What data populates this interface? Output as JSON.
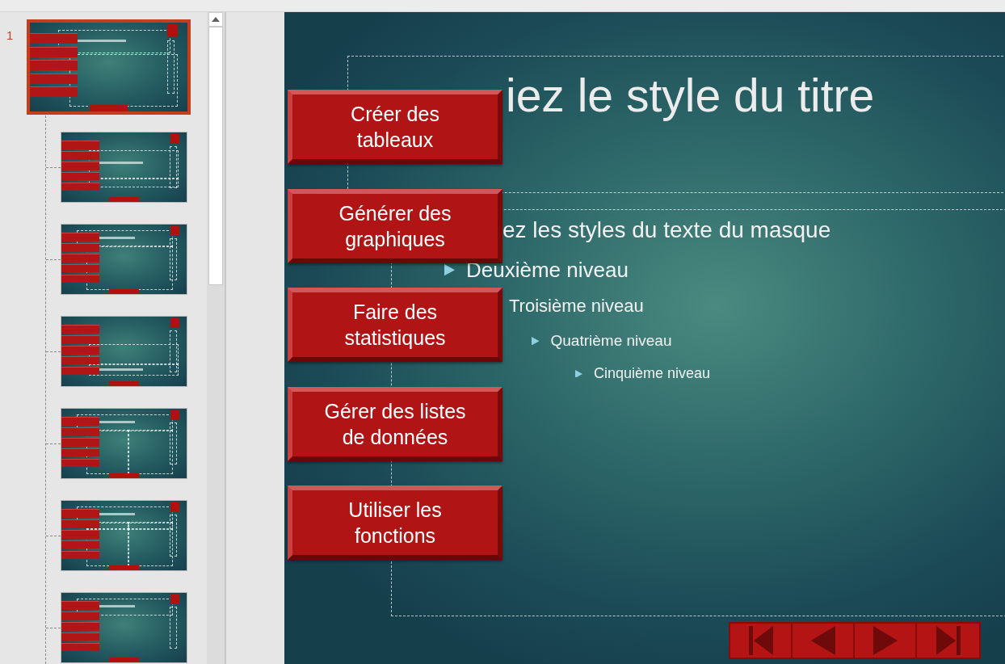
{
  "thumbnails_panel": {
    "slide_number": "1",
    "thumbnails": [
      {
        "kind": "master",
        "selected": true
      },
      {
        "kind": "title",
        "selected": false
      },
      {
        "kind": "content",
        "selected": false
      },
      {
        "kind": "section",
        "selected": false
      },
      {
        "kind": "two-content",
        "selected": false
      },
      {
        "kind": "comparison",
        "selected": false
      },
      {
        "kind": "title-only",
        "selected": false
      }
    ]
  },
  "slide": {
    "title": "iez le style du titre",
    "body": [
      {
        "text": "ez les styles du texte du masque",
        "children": [
          {
            "text": "Deuxième niveau",
            "children": [
              {
                "text": "Troisième niveau",
                "children": [
                  {
                    "text": "Quatrième niveau",
                    "children": [
                      {
                        "text": "Cinquième niveau"
                      }
                    ]
                  }
                ]
              }
            ]
          }
        ]
      }
    ],
    "side_buttons": [
      "Créer des tableaux",
      "Générer des graphiques",
      "Faire des statistiques",
      "Gérer des listes de données",
      "Utiliser les fonctions"
    ],
    "nav_buttons": [
      {
        "kind": "first"
      },
      {
        "kind": "previous"
      },
      {
        "kind": "next"
      },
      {
        "kind": "last"
      }
    ]
  }
}
